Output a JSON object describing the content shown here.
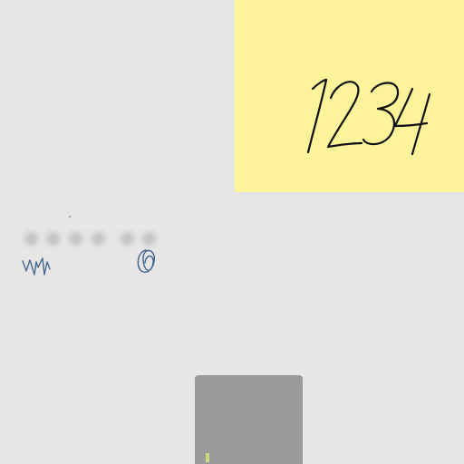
{
  "sticky_note": {
    "handwritten_code": "1234",
    "color": "#fdf39a"
  },
  "pin_entry": {
    "dot_count": 6,
    "scribble_color": "#4a6a93"
  },
  "keypad": {
    "color": "#9b9b9b"
  },
  "colors": {
    "background": "#e6e6e6",
    "ink": "#111111"
  }
}
